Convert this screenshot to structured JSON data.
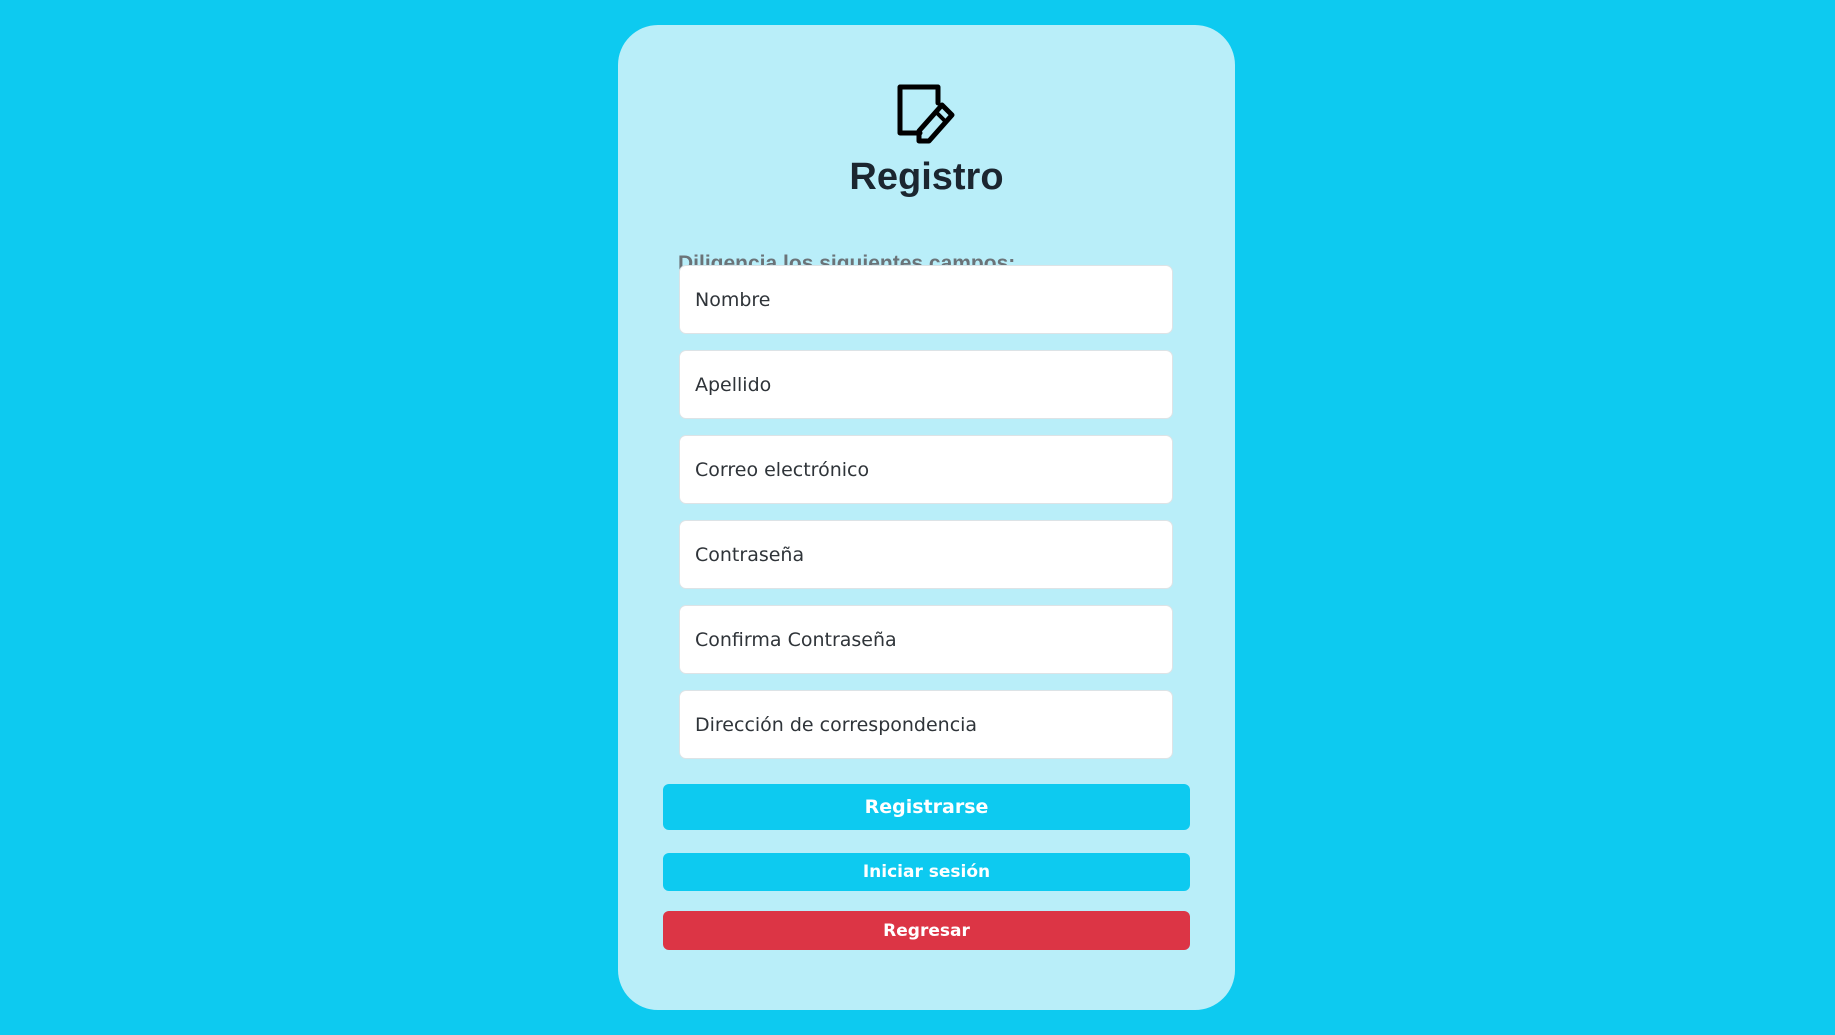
{
  "colors": {
    "background": "#0dcaf0",
    "card": "#b9eef9",
    "primary_button": "#0dcaf0",
    "danger_button": "#dc3545"
  },
  "header": {
    "icon": "pencil-square-icon",
    "title": "Registro"
  },
  "form": {
    "instruction": "Diligencia los siguientes campos:",
    "fields": {
      "nombre": {
        "placeholder": "Nombre",
        "value": ""
      },
      "apellido": {
        "placeholder": "Apellido",
        "value": ""
      },
      "correo": {
        "placeholder": "Correo electrónico",
        "value": ""
      },
      "contrasena": {
        "placeholder": "Contraseña",
        "value": ""
      },
      "confirma_contrasena": {
        "placeholder": "Confirma Contraseña",
        "value": ""
      },
      "direccion": {
        "placeholder": "Dirección de correspondencia",
        "value": ""
      }
    }
  },
  "actions": {
    "register_label": "Registrarse",
    "login_label": "Iniciar sesión",
    "back_label": "Regresar"
  }
}
